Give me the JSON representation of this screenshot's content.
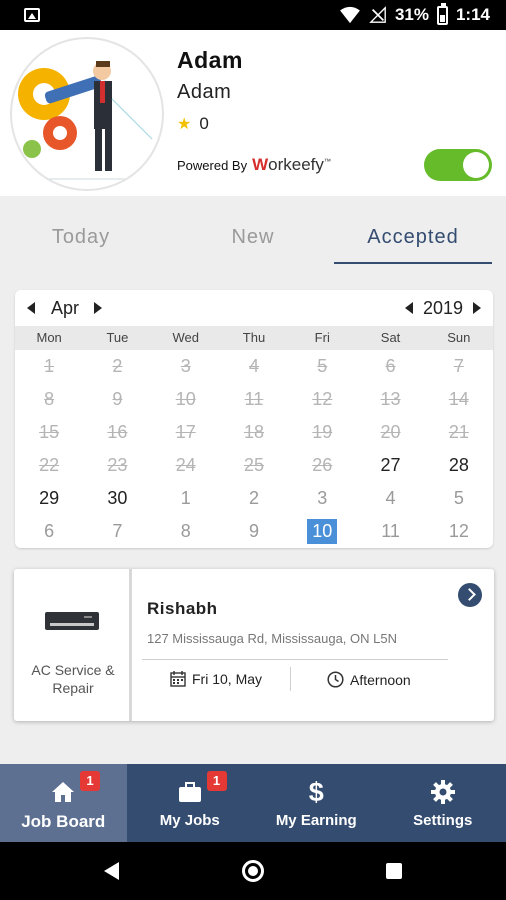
{
  "status_bar": {
    "battery": "31%",
    "time": "1:14"
  },
  "profile": {
    "name": "Adam",
    "username": "Adam",
    "rating": "0",
    "powered_by": "Powered By",
    "brand_w": "W",
    "brand_rest": "orkeefy",
    "brand_tm": "™",
    "availability_on": true
  },
  "tabs": [
    {
      "label": "Today",
      "active": false
    },
    {
      "label": "New",
      "active": false
    },
    {
      "label": "Accepted",
      "active": true
    }
  ],
  "calendar": {
    "month": "Apr",
    "year": "2019",
    "weekdays": [
      "Mon",
      "Tue",
      "Wed",
      "Thu",
      "Fri",
      "Sat",
      "Sun"
    ],
    "weeks": [
      [
        {
          "d": "1",
          "s": "past"
        },
        {
          "d": "2",
          "s": "past"
        },
        {
          "d": "3",
          "s": "past"
        },
        {
          "d": "4",
          "s": "past"
        },
        {
          "d": "5",
          "s": "past"
        },
        {
          "d": "6",
          "s": "past"
        },
        {
          "d": "7",
          "s": "past"
        }
      ],
      [
        {
          "d": "8",
          "s": "past"
        },
        {
          "d": "9",
          "s": "past"
        },
        {
          "d": "10",
          "s": "past"
        },
        {
          "d": "11",
          "s": "past"
        },
        {
          "d": "12",
          "s": "past"
        },
        {
          "d": "13",
          "s": "past"
        },
        {
          "d": "14",
          "s": "past"
        }
      ],
      [
        {
          "d": "15",
          "s": "past"
        },
        {
          "d": "16",
          "s": "past"
        },
        {
          "d": "17",
          "s": "past"
        },
        {
          "d": "18",
          "s": "past"
        },
        {
          "d": "19",
          "s": "past"
        },
        {
          "d": "20",
          "s": "past"
        },
        {
          "d": "21",
          "s": "past"
        }
      ],
      [
        {
          "d": "22",
          "s": "past"
        },
        {
          "d": "23",
          "s": "past"
        },
        {
          "d": "24",
          "s": "past"
        },
        {
          "d": "25",
          "s": "past"
        },
        {
          "d": "26",
          "s": "past"
        },
        {
          "d": "27",
          "s": "cur"
        },
        {
          "d": "28",
          "s": "cur"
        }
      ],
      [
        {
          "d": "29",
          "s": "cur"
        },
        {
          "d": "30",
          "s": "cur"
        },
        {
          "d": "1",
          "s": "next"
        },
        {
          "d": "2",
          "s": "next"
        },
        {
          "d": "3",
          "s": "next"
        },
        {
          "d": "4",
          "s": "next"
        },
        {
          "d": "5",
          "s": "next"
        }
      ],
      [
        {
          "d": "6",
          "s": "next"
        },
        {
          "d": "7",
          "s": "next"
        },
        {
          "d": "8",
          "s": "next"
        },
        {
          "d": "9",
          "s": "next"
        },
        {
          "d": "10",
          "s": "selected"
        },
        {
          "d": "11",
          "s": "next"
        },
        {
          "d": "12",
          "s": "next"
        }
      ]
    ],
    "selected_color": "#4a90d9"
  },
  "job": {
    "service": "AC Service & Repair",
    "customer": "Rishabh",
    "address": "127 Mississauga Rd, Mississauga, ON L5N",
    "date": "Fri 10, May",
    "time_slot": "Afternoon"
  },
  "bottom_nav": [
    {
      "label": "Job Board",
      "icon": "home-icon",
      "badge": "1",
      "active": true
    },
    {
      "label": "My Jobs",
      "icon": "briefcase-icon",
      "badge": "1",
      "active": false
    },
    {
      "label": "My Earning",
      "icon": "dollar-icon",
      "badge": "",
      "active": false
    },
    {
      "label": "Settings",
      "icon": "gear-icon",
      "badge": "",
      "active": false
    }
  ],
  "colors": {
    "primary": "#344c70",
    "toggle_on": "#66bb2b",
    "badge": "#e53935",
    "accent_red": "#d62d2d"
  }
}
